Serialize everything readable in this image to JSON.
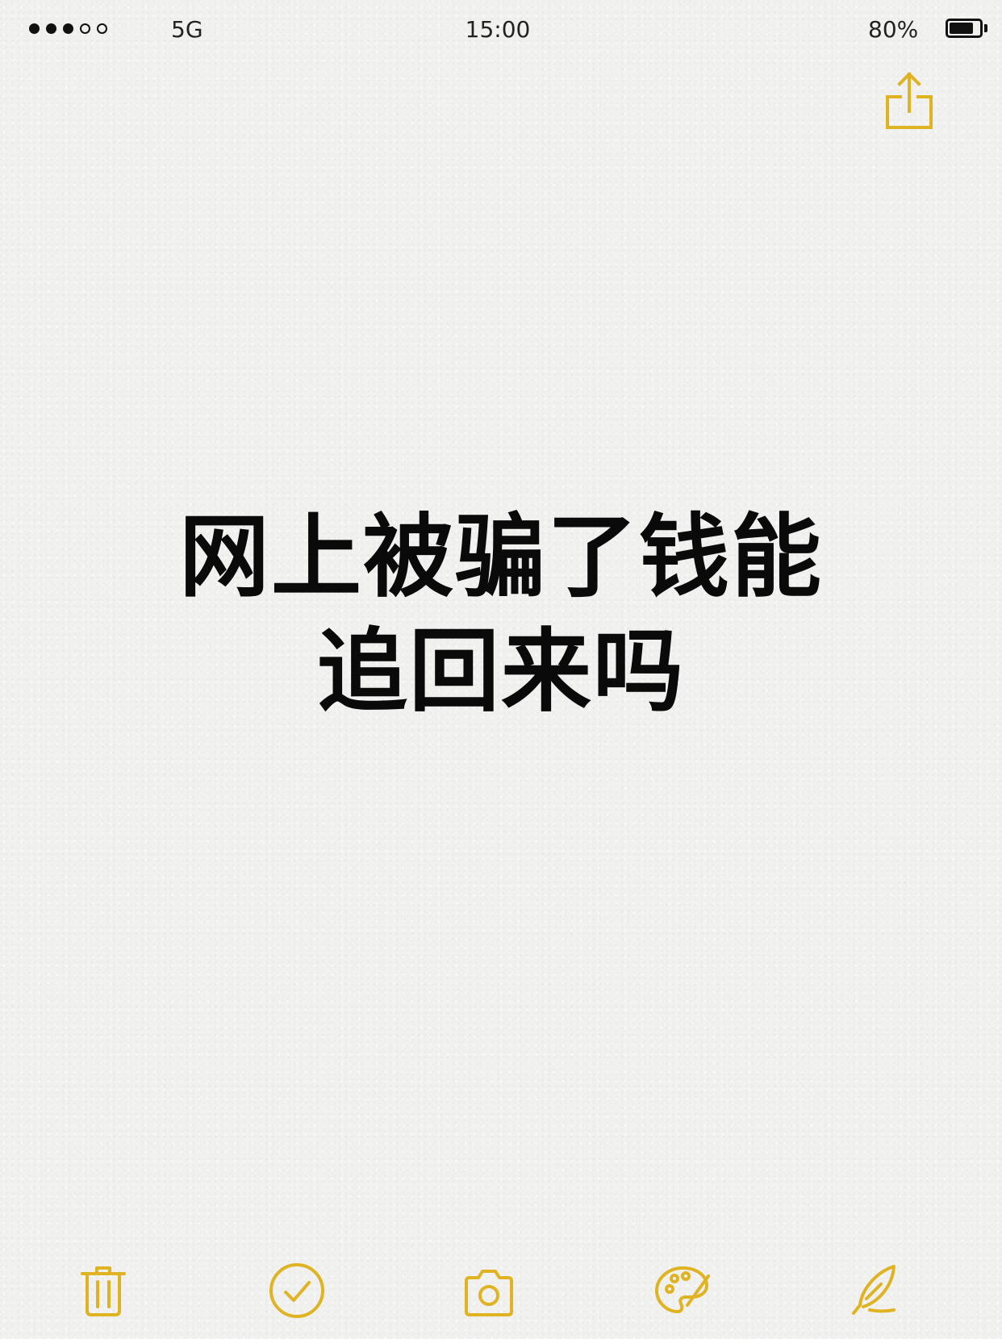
{
  "status_bar": {
    "signal_filled": 3,
    "signal_total": 5,
    "carrier": "5G",
    "time": "15:00",
    "battery_percent_label": "80%",
    "battery_level": 0.8
  },
  "header": {
    "share_icon": "share-icon"
  },
  "note": {
    "line1": "网上被骗了钱能",
    "line2": "追回来吗"
  },
  "toolbar": {
    "icons": [
      "trash-icon",
      "checklist-icon",
      "camera-icon",
      "palette-icon",
      "pen-icon"
    ]
  },
  "colors": {
    "accent": "#E0B323",
    "text": "#0a0a0a",
    "background": "#f1f1f0"
  }
}
